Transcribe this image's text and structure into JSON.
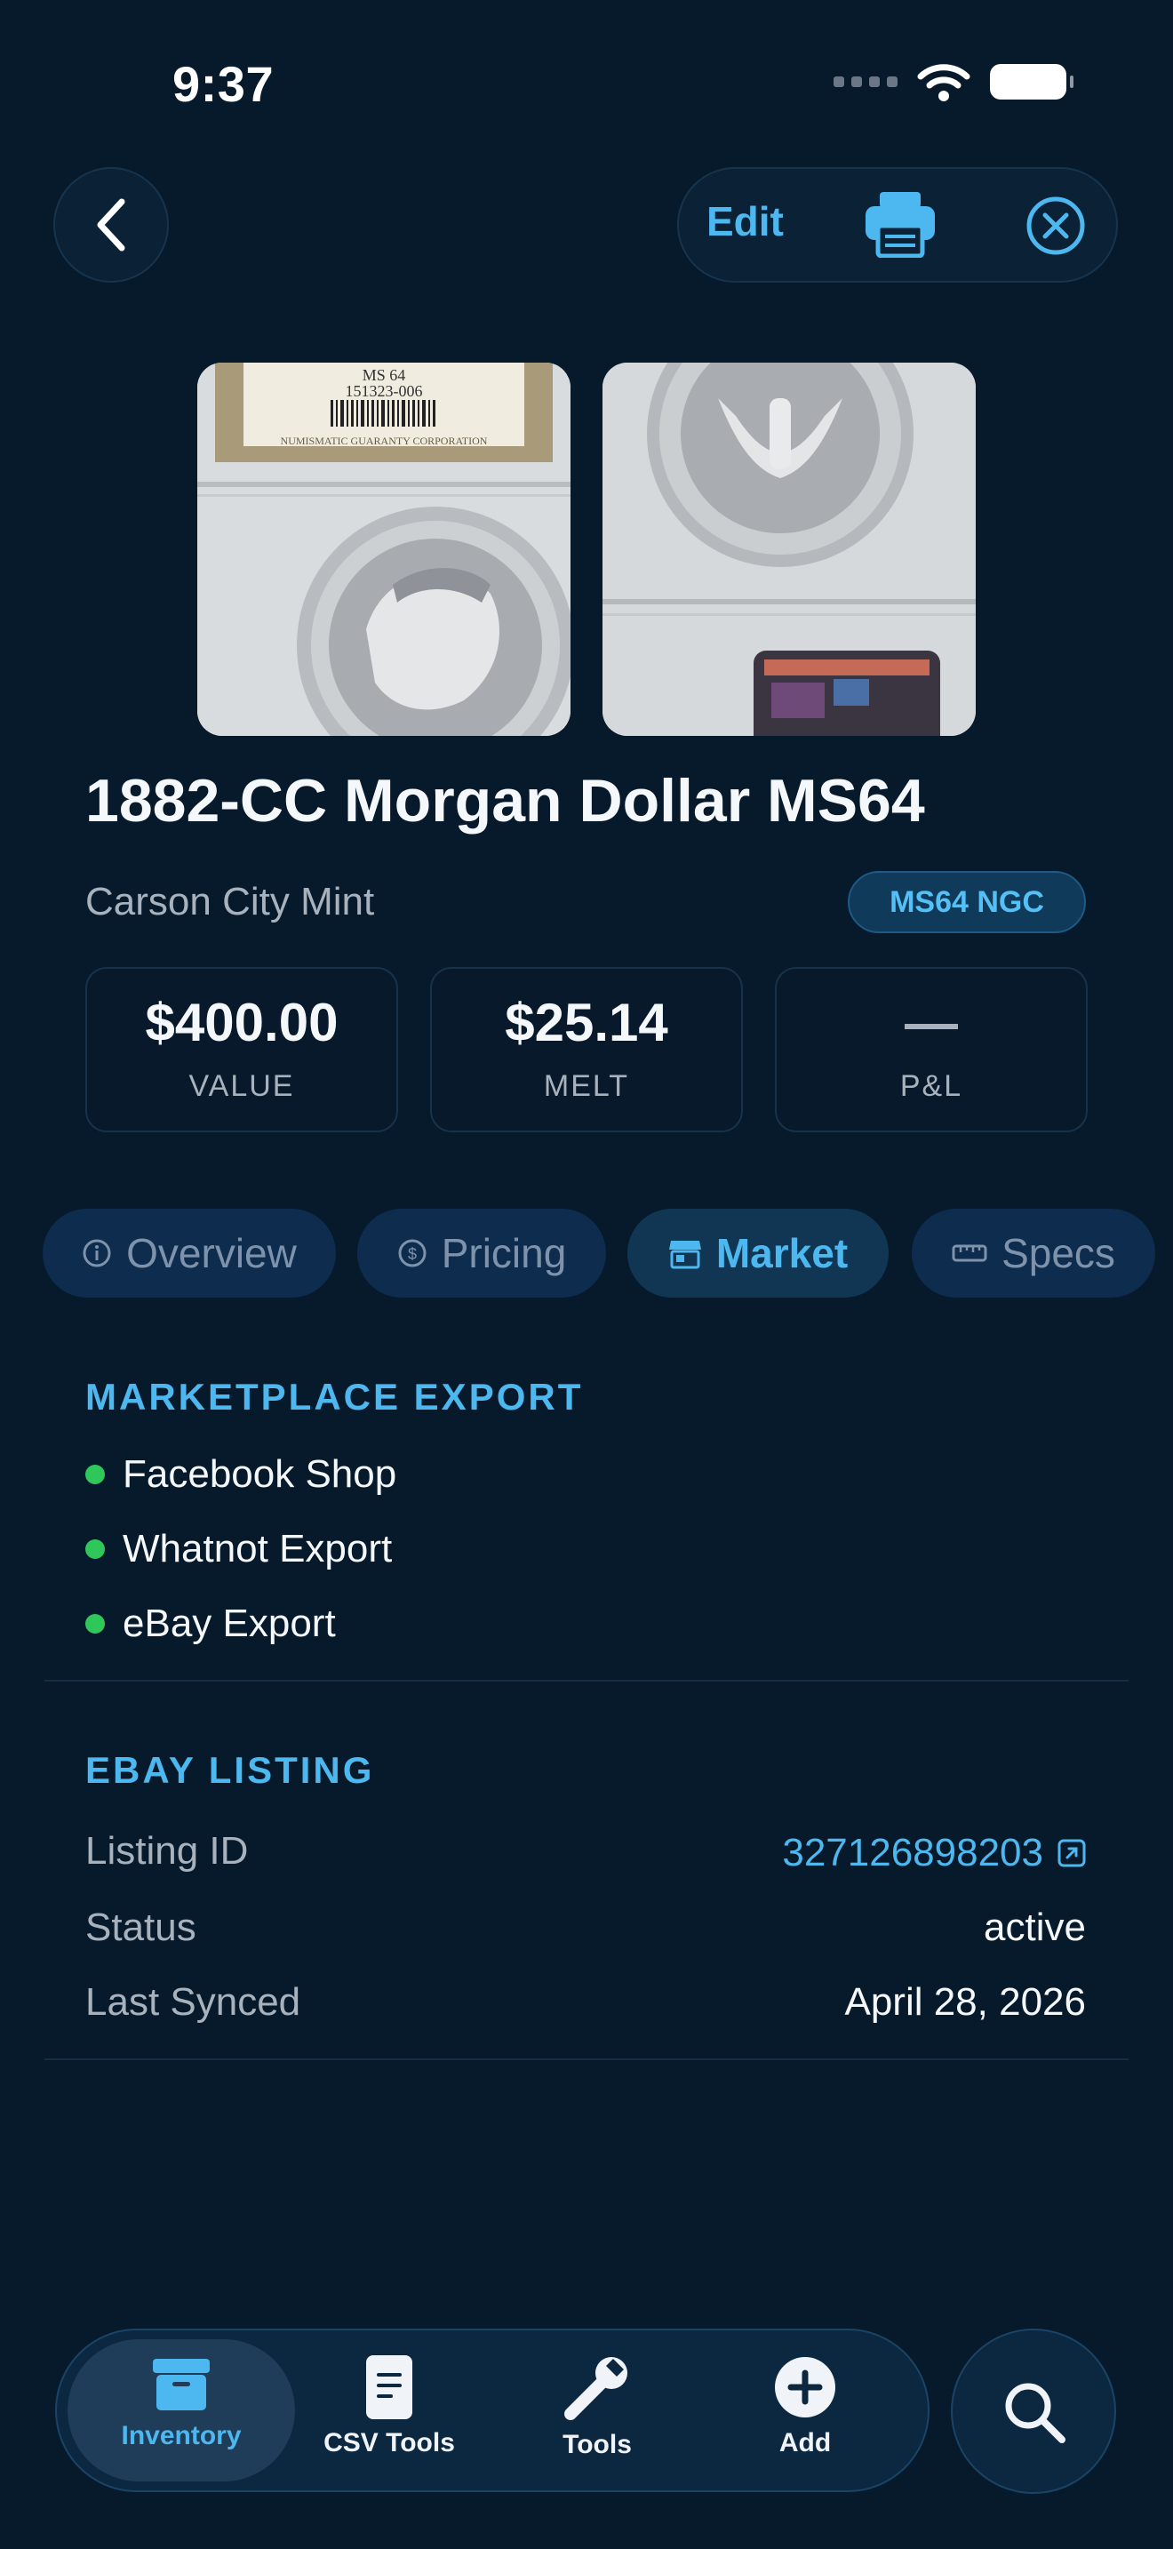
{
  "status_bar": {
    "time": "9:37"
  },
  "header": {
    "edit_label": "Edit"
  },
  "coin": {
    "title": "1882-CC Morgan Dollar MS64",
    "mint": "Carson City Mint",
    "grade_badge": "MS64 NGC",
    "slab_label_grade": "MS 64",
    "slab_label_cert": "151323-006",
    "slab_label_company": "NUMISMATIC GUARANTY CORPORATION"
  },
  "stats": [
    {
      "value": "$400.00",
      "label": "VALUE"
    },
    {
      "value": "$25.14",
      "label": "MELT"
    },
    {
      "value": "—",
      "label": "P&L"
    }
  ],
  "tabs": [
    {
      "label": "Overview",
      "icon": "info-icon"
    },
    {
      "label": "Pricing",
      "icon": "dollar-circle-icon"
    },
    {
      "label": "Market",
      "icon": "storefront-icon",
      "active": true
    },
    {
      "label": "Specs",
      "icon": "ruler-icon"
    }
  ],
  "marketplace_export": {
    "title": "MARKETPLACE EXPORT",
    "items": [
      "Facebook Shop",
      "Whatnot Export",
      "eBay Export"
    ]
  },
  "ebay_listing": {
    "title": "EBAY LISTING",
    "rows": [
      {
        "label": "Listing ID",
        "value": "327126898203"
      },
      {
        "label": "Status",
        "value": "active"
      },
      {
        "label": "Last Synced",
        "value": "April 28, 2026"
      }
    ]
  },
  "bottom_nav": {
    "items": [
      {
        "label": "Inventory",
        "icon": "archive-box-icon",
        "active": true
      },
      {
        "label": "CSV Tools",
        "icon": "document-icon"
      },
      {
        "label": "Tools",
        "icon": "wrench-icon"
      },
      {
        "label": "Add",
        "icon": "plus-circle-icon"
      }
    ],
    "search_icon": "search-icon"
  },
  "colors": {
    "background": "#071a2b",
    "accent": "#4db7f0",
    "status_green": "#2fc75a"
  }
}
